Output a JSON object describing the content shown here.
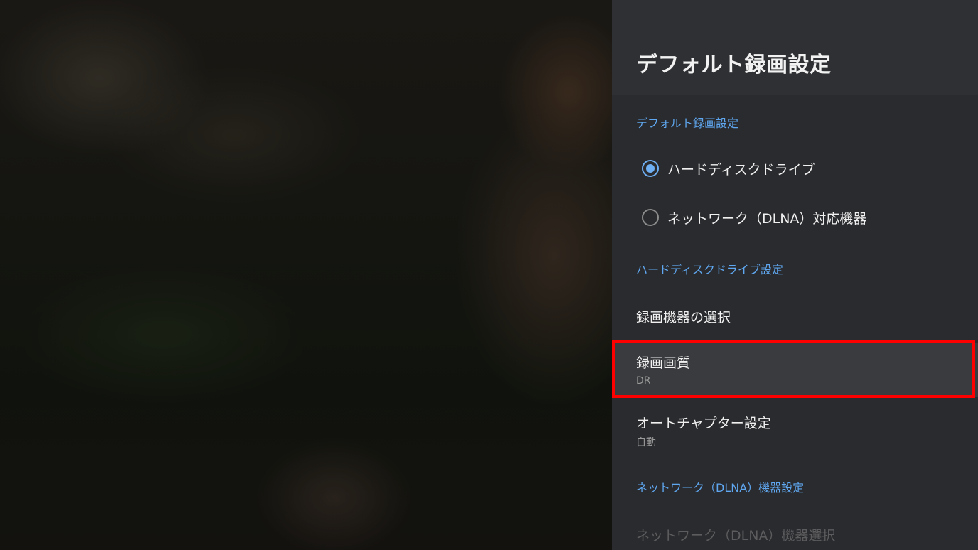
{
  "panel": {
    "title": "デフォルト録画設定",
    "sections": {
      "default_recording": {
        "label": "デフォルト録画設定",
        "options": [
          {
            "label": "ハードディスクドライブ",
            "selected": true
          },
          {
            "label": "ネットワーク（DLNA）対応機器",
            "selected": false
          }
        ]
      },
      "hdd": {
        "label": "ハードディスクドライブ設定",
        "items": [
          {
            "title": "録画機器の選択"
          },
          {
            "title": "録画画質",
            "value": "DR"
          },
          {
            "title": "オートチャプター設定",
            "value": "自動"
          }
        ]
      },
      "dlna": {
        "label": "ネットワーク（DLNA）機器設定",
        "items": [
          {
            "title": "ネットワーク（DLNA）機器選択",
            "disabled": true
          }
        ]
      }
    }
  },
  "colors": {
    "accent": "#6fb0f5",
    "section_label": "#5fa7f0",
    "highlight": "#ff0000",
    "panel_bg": "#2a2b2e"
  }
}
